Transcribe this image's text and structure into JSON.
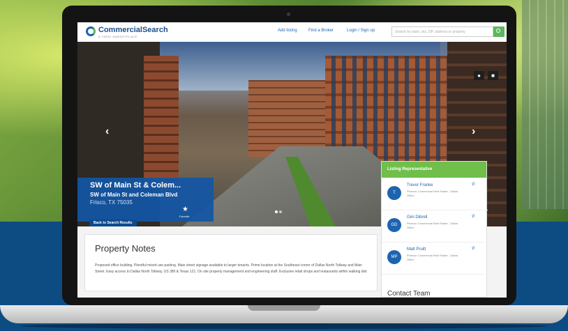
{
  "site": {
    "brand": "CommercialSearch",
    "brand_tagline": "A YARDI MARKETPLACE"
  },
  "nav": {
    "add_listing": "Add listing",
    "find_broker": "Find a Broker",
    "login": "Login / Sign up",
    "search_placeholder": "Search by state, city, ZIP, address or property"
  },
  "hero": {
    "prev_arrow": "‹",
    "next_arrow": "›",
    "map_icon": "map-pin-icon",
    "photo_icon": "camera-icon"
  },
  "property": {
    "title": "SW of Main St & Colem...",
    "address": "SW of Main St and Coleman Blvd",
    "city": "Frisco, TX 75035",
    "favorite_label": "Favorite",
    "back_button": "Back to Search Results"
  },
  "reps": {
    "heading": "Listing Representative",
    "items": [
      {
        "initials": "T",
        "name": "Trevor Franke",
        "company": "Pinecon Commercial Real Estate - Dallas Office"
      },
      {
        "initials": "GD",
        "name": "Gini Dibrell",
        "company": "Pinecon Commercial Real Estate - Dallas Office"
      },
      {
        "initials": "MP",
        "name": "Matt Pruitt",
        "company": "Pinecon Commercial Real Estate - Dallas Office"
      }
    ],
    "contact_heading": "Contact Team"
  },
  "notes": {
    "title": "Property Notes",
    "body": "Proposed office building. Plentiful mixed use parking. Main street signage available to larger tenants. Prime location at the Southeast corner of Dallas North Tollway and Main Street. Easy access to Dallas North Tollway, US 380 & Texas 121. On site property management and engineering staff. Exclusive retail shops and restaurants within walking dist"
  }
}
